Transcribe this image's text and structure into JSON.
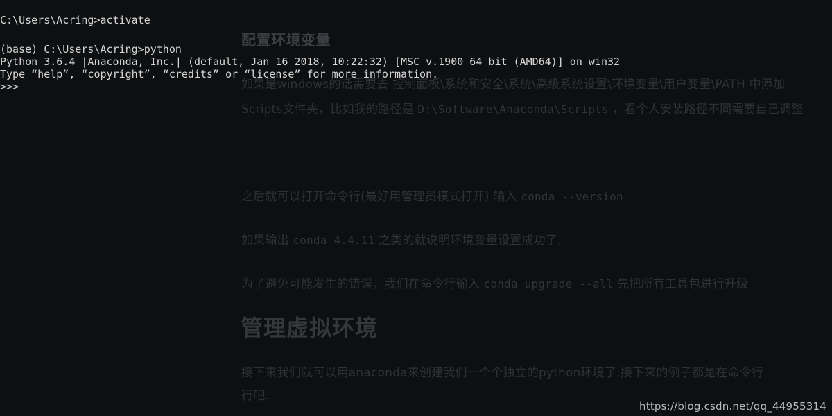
{
  "page": {
    "background_color": "#0d0f11",
    "terminal_text_color": "#d6d6d6",
    "article_text_color": "#2f3235",
    "watermark_color": "#b9bcbe"
  },
  "terminal": {
    "lines": [
      "C:\\Users\\Acring>activate",
      "(base) C:\\Users\\Acring>python",
      "Python 3.6.4 |Anaconda, Inc.| (default, Jan 16 2018, 10:22:32) [MSC v.1900 64 bit (AMD64)] on win32",
      "Type “help”, “copyright”, “credits” or “license” for more information.",
      ">>>"
    ]
  },
  "article": {
    "heading_env": "配置环境变量",
    "heading_venv": "管理虚拟环境",
    "para_env_path": "如果是windows的话需要去 控制面板\\系统和安全\\系统\\高级系统设置\\环境变量\\用户变量\\PATH 中添加",
    "para_scripts_pre": "Scripts文件夹，比如我的路径是 ",
    "para_scripts_code": "D:\\Software\\Anaconda\\Scripts",
    "para_scripts_post": " ，看个人安装路径不同需要自己调整",
    "para_cmdline_pre": "之后就可以打开命令行(最好用管理员模式打开) 输入 ",
    "para_cmdline_code": "conda --version",
    "para_condaver_pre": "如果输出 ",
    "para_condaver_code": "conda 4.4.11",
    "para_condaver_post": " 之类的就说明环境变量设置成功了.",
    "para_upgrade_pre": "为了避免可能发生的错误，我们在命令行输入 ",
    "para_upgrade_code": "conda upgrade --all",
    "para_upgrade_post": " 先把所有工具包进行升级",
    "para_anaconda_line1": "接下来我们就可以用anaconda来创建我们一个个独立的python环境了.接下来的例子都是在命令行",
    "para_anaconda_line2": "行吧."
  },
  "watermark": {
    "url": "https://blog.csdn.net/qq_44955314"
  }
}
